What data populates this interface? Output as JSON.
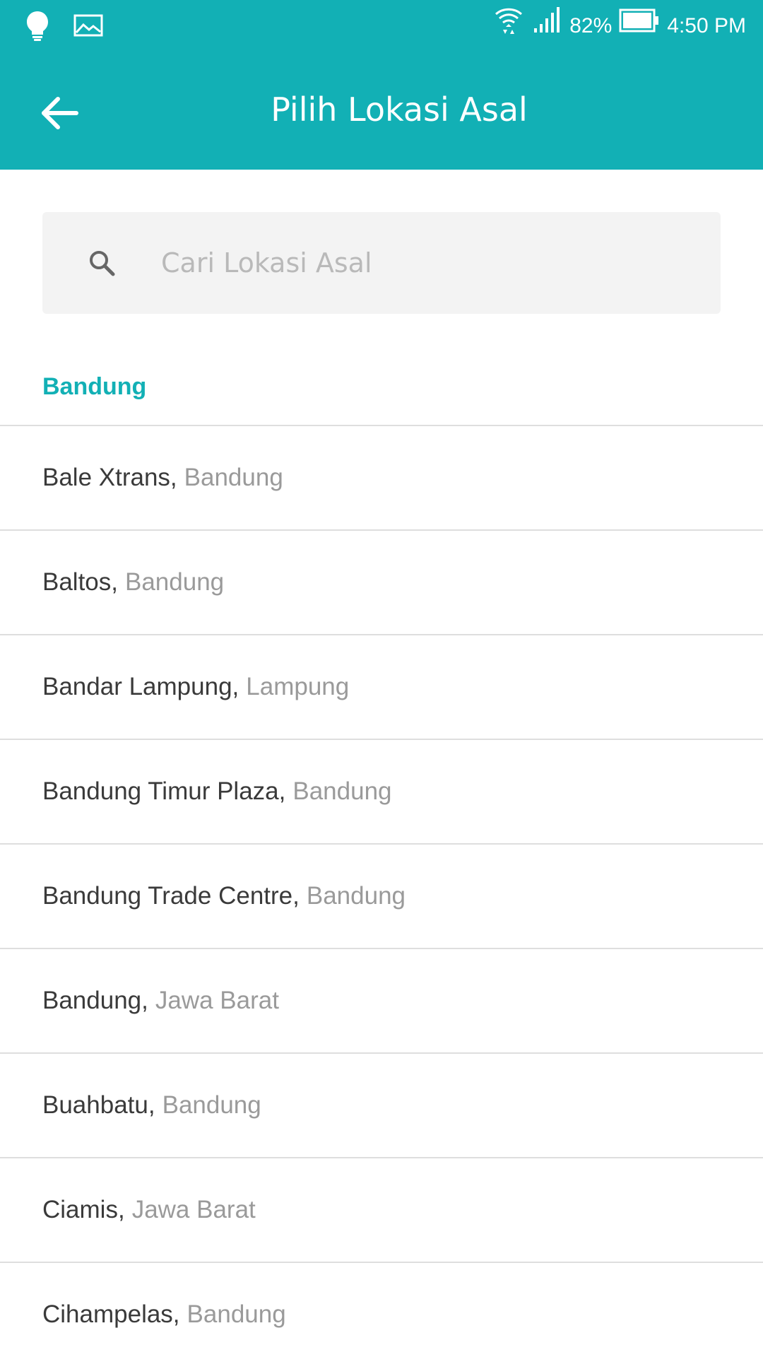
{
  "status_bar": {
    "battery": "82%",
    "time": "4:50 PM"
  },
  "toolbar": {
    "title": "Pilih Lokasi Asal"
  },
  "search": {
    "placeholder": "Cari Lokasi Asal",
    "value": ""
  },
  "section": {
    "title": "Bandung"
  },
  "locations": [
    {
      "name": "Bale Xtrans,",
      "region": "Bandung"
    },
    {
      "name": "Baltos,",
      "region": "Bandung"
    },
    {
      "name": "Bandar Lampung,",
      "region": "Lampung"
    },
    {
      "name": "Bandung Timur Plaza,",
      "region": "Bandung"
    },
    {
      "name": "Bandung Trade Centre,",
      "region": "Bandung"
    },
    {
      "name": "Bandung,",
      "region": "Jawa Barat"
    },
    {
      "name": "Buahbatu,",
      "region": "Bandung"
    },
    {
      "name": "Ciamis,",
      "region": "Jawa Barat"
    },
    {
      "name": "Cihampelas,",
      "region": "Bandung"
    }
  ],
  "colors": {
    "accent": "#12b0b5",
    "primary_text": "#3a3a3a",
    "secondary_text": "#9a9a9a",
    "divider": "#dedede",
    "search_bg": "#f3f3f3"
  }
}
